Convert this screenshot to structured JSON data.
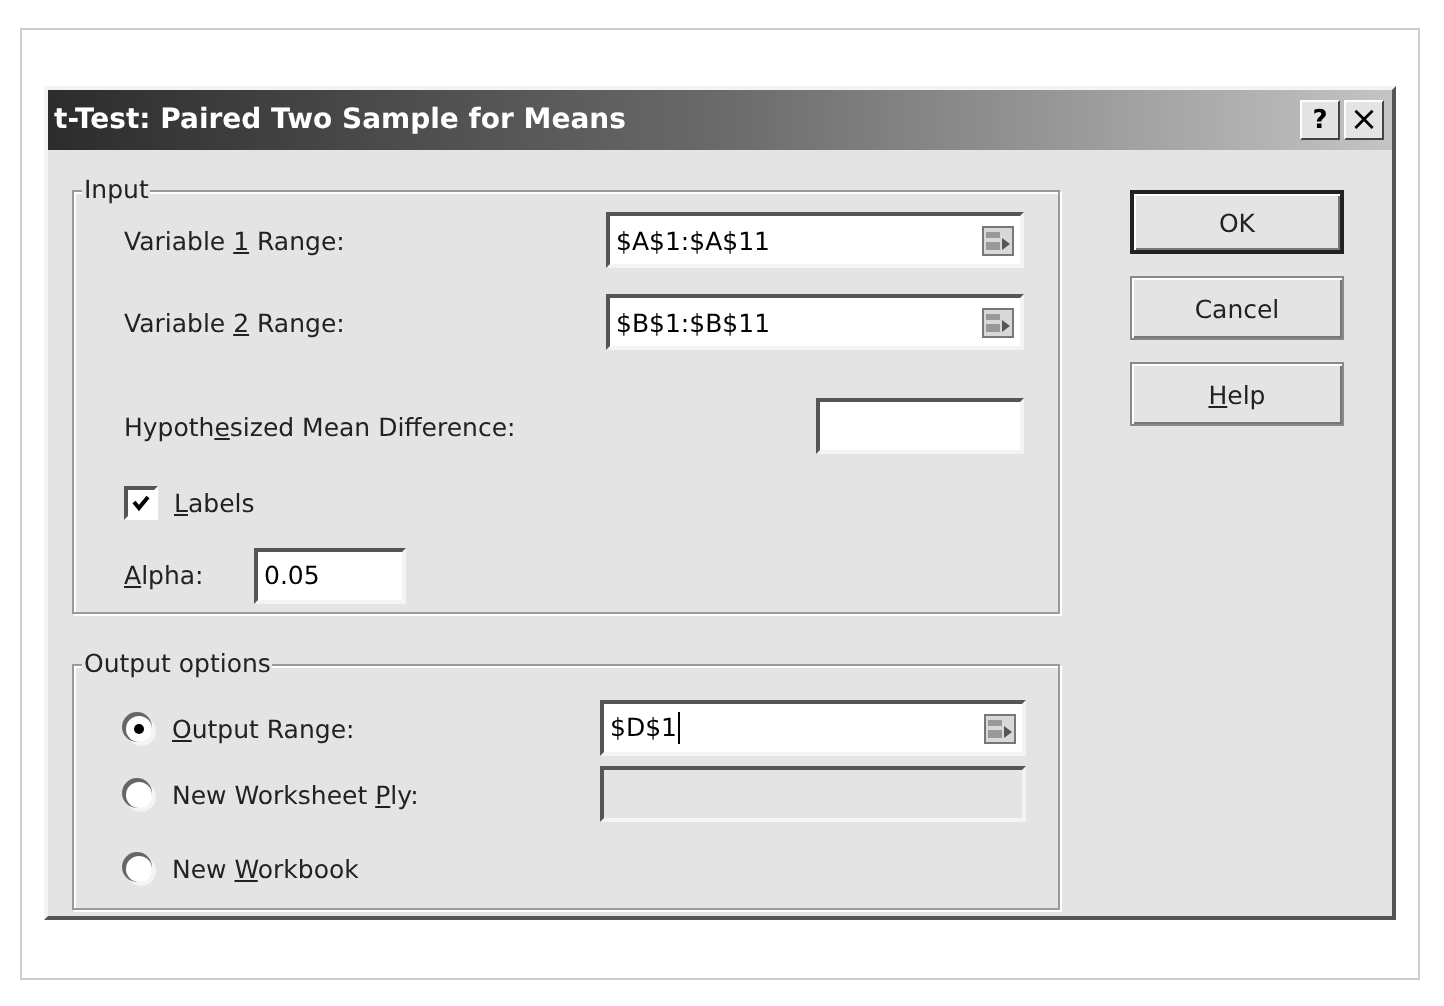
{
  "window": {
    "title": "t-Test: Paired Two Sample for Means",
    "title_buttons": [
      {
        "kind": "help",
        "label": "?"
      },
      {
        "kind": "close",
        "label": "×"
      }
    ]
  },
  "input": {
    "legend": "Input",
    "variable_1": {
      "label": {
        "pre": "Variable ",
        "key": "1",
        "post": " Range:"
      },
      "value": "$A$1:$A$11"
    },
    "variable_2": {
      "label": {
        "pre": "Variable ",
        "key": "2",
        "post": " Range:"
      },
      "value": "$B$1:$B$11"
    },
    "mean_difference": {
      "label": {
        "pre": "Hypoth",
        "key": "e",
        "post": "sized Mean Difference:"
      }
    },
    "labels": {
      "label": {
        "key": "L",
        "post": "abels"
      },
      "checked": true
    },
    "alpha": {
      "label": {
        "key": "A",
        "post": "lpha:"
      },
      "value": "0.05"
    }
  },
  "output": {
    "legend": "Output options",
    "options": [
      {
        "label": {
          "key": "O",
          "post": "utput Range:"
        },
        "selected": true,
        "kind": "range",
        "value": "$D$1",
        "disabled": false
      },
      {
        "label": {
          "pre": "New Worksheet ",
          "key": "P",
          "post": "ly:"
        },
        "selected": false,
        "kind": "plain",
        "disabled": true
      },
      {
        "label": {
          "pre": "New ",
          "key": "W",
          "post": "orkbook"
        },
        "selected": false,
        "kind": "none"
      }
    ]
  },
  "buttons": [
    {
      "label": {
        "post": "OK"
      },
      "default": true
    },
    {
      "label": {
        "post": "Cancel"
      },
      "default": false
    },
    {
      "label": {
        "key": "H",
        "post": "elp"
      },
      "default": false
    }
  ]
}
